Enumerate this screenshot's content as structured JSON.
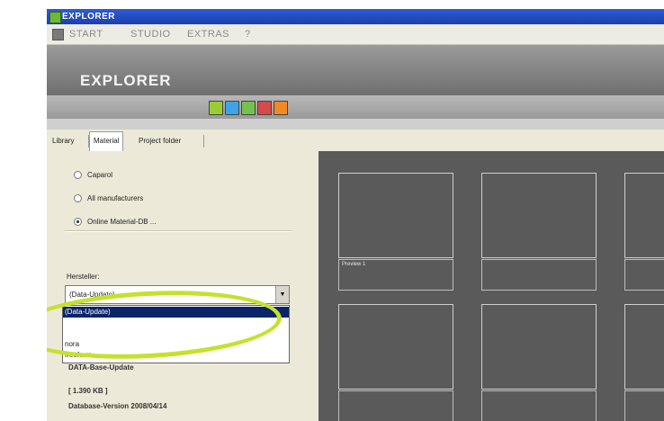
{
  "window": {
    "title": "EXPLORER"
  },
  "menu": {
    "items": [
      "START",
      "STUDIO",
      "EXTRAS",
      "?"
    ]
  },
  "header": {
    "title": "EXPLORER"
  },
  "toolbar": {
    "buttons": [
      {
        "name": "list-view-icon",
        "color": "#9acd32"
      },
      {
        "name": "tile-view-icon",
        "color": "#3da4e8"
      },
      {
        "name": "image-view-icon",
        "color": "#74c14b"
      },
      {
        "name": "box-view-icon",
        "color": "#d64a4a"
      },
      {
        "name": "grid-view-icon",
        "color": "#f08a24"
      }
    ]
  },
  "tabs": [
    {
      "label": "Library",
      "active": false
    },
    {
      "label": "Material",
      "active": true
    },
    {
      "label": "Project folder",
      "active": false
    }
  ],
  "radios": [
    {
      "label": "Caparol",
      "checked": false
    },
    {
      "label": "All manufacturers",
      "checked": false
    },
    {
      "label": "Online Material-DB ...",
      "checked": true
    }
  ],
  "manufacturer": {
    "label": "Hersteller:",
    "value": "(Data-Update)",
    "options": [
      "(Data-Update)",
      "",
      "",
      "nora",
      "freeform"
    ]
  },
  "info": {
    "title": "DATA-Base-Update",
    "size": "[ 1.390 KB ]",
    "version": "Database-Version 2008/04/14"
  },
  "previews": {
    "first_label": "Preview 1"
  },
  "colors": {
    "highlight": "#c6e12d",
    "selection": "#0a246a",
    "preview_bg": "#5a5a5a"
  }
}
